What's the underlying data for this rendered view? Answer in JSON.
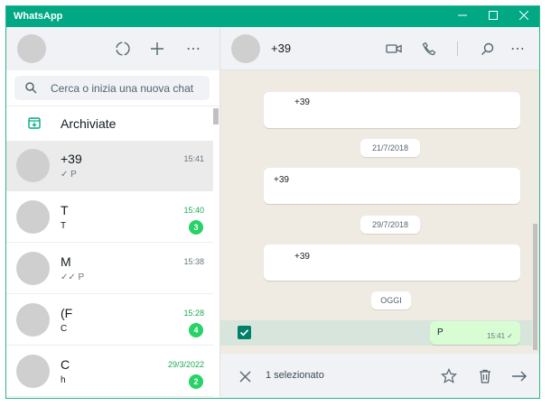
{
  "window": {
    "title": "WhatsApp",
    "accent_color": "#00a884",
    "controls": {
      "minimize": "—",
      "maximize": "☐",
      "close": "✕"
    }
  },
  "left_header": {
    "icons": [
      "status-icon",
      "new-chat-icon",
      "menu-icon"
    ],
    "menu_glyph": "⋯"
  },
  "search": {
    "placeholder": "Cerca o inizia una nuova chat"
  },
  "archived": {
    "label": "Archiviate"
  },
  "chats": [
    {
      "name": "+39",
      "time": "15:41",
      "time_color": "grey",
      "preview": "✓ P",
      "badge": "",
      "selected": true
    },
    {
      "name": "T",
      "time": "15:40",
      "time_color": "green",
      "preview": "T",
      "badge": "3",
      "selected": false
    },
    {
      "name": "M",
      "time": "15:38",
      "time_color": "grey",
      "preview": "✓✓ P",
      "badge": "",
      "selected": false
    },
    {
      "name": "(F",
      "time": "15:28",
      "time_color": "green",
      "preview": "C",
      "badge": "4",
      "selected": false
    },
    {
      "name": "C",
      "time": "29/3/2022",
      "time_color": "green",
      "preview": "h",
      "badge": "2",
      "selected": false
    }
  ],
  "conversation": {
    "contact_name": "+39",
    "header_icons": [
      "video-call-icon",
      "voice-call-icon",
      "search-icon",
      "menu-icon"
    ],
    "menu_glyph": "⋯",
    "messages": [
      {
        "text": "+39"
      },
      {
        "date": "21/7/2018"
      },
      {
        "text": "+39"
      },
      {
        "date": "29/7/2018"
      },
      {
        "text": "+39"
      },
      {
        "date": "OGGI"
      }
    ],
    "outgoing": {
      "text": "P",
      "time": "15:41",
      "status": "✓"
    },
    "selection": {
      "count_label": "1 selezionato",
      "checkbox_checked": true
    }
  },
  "footer": {
    "icons": [
      "close-icon",
      "star-icon",
      "delete-icon",
      "forward-icon"
    ]
  }
}
